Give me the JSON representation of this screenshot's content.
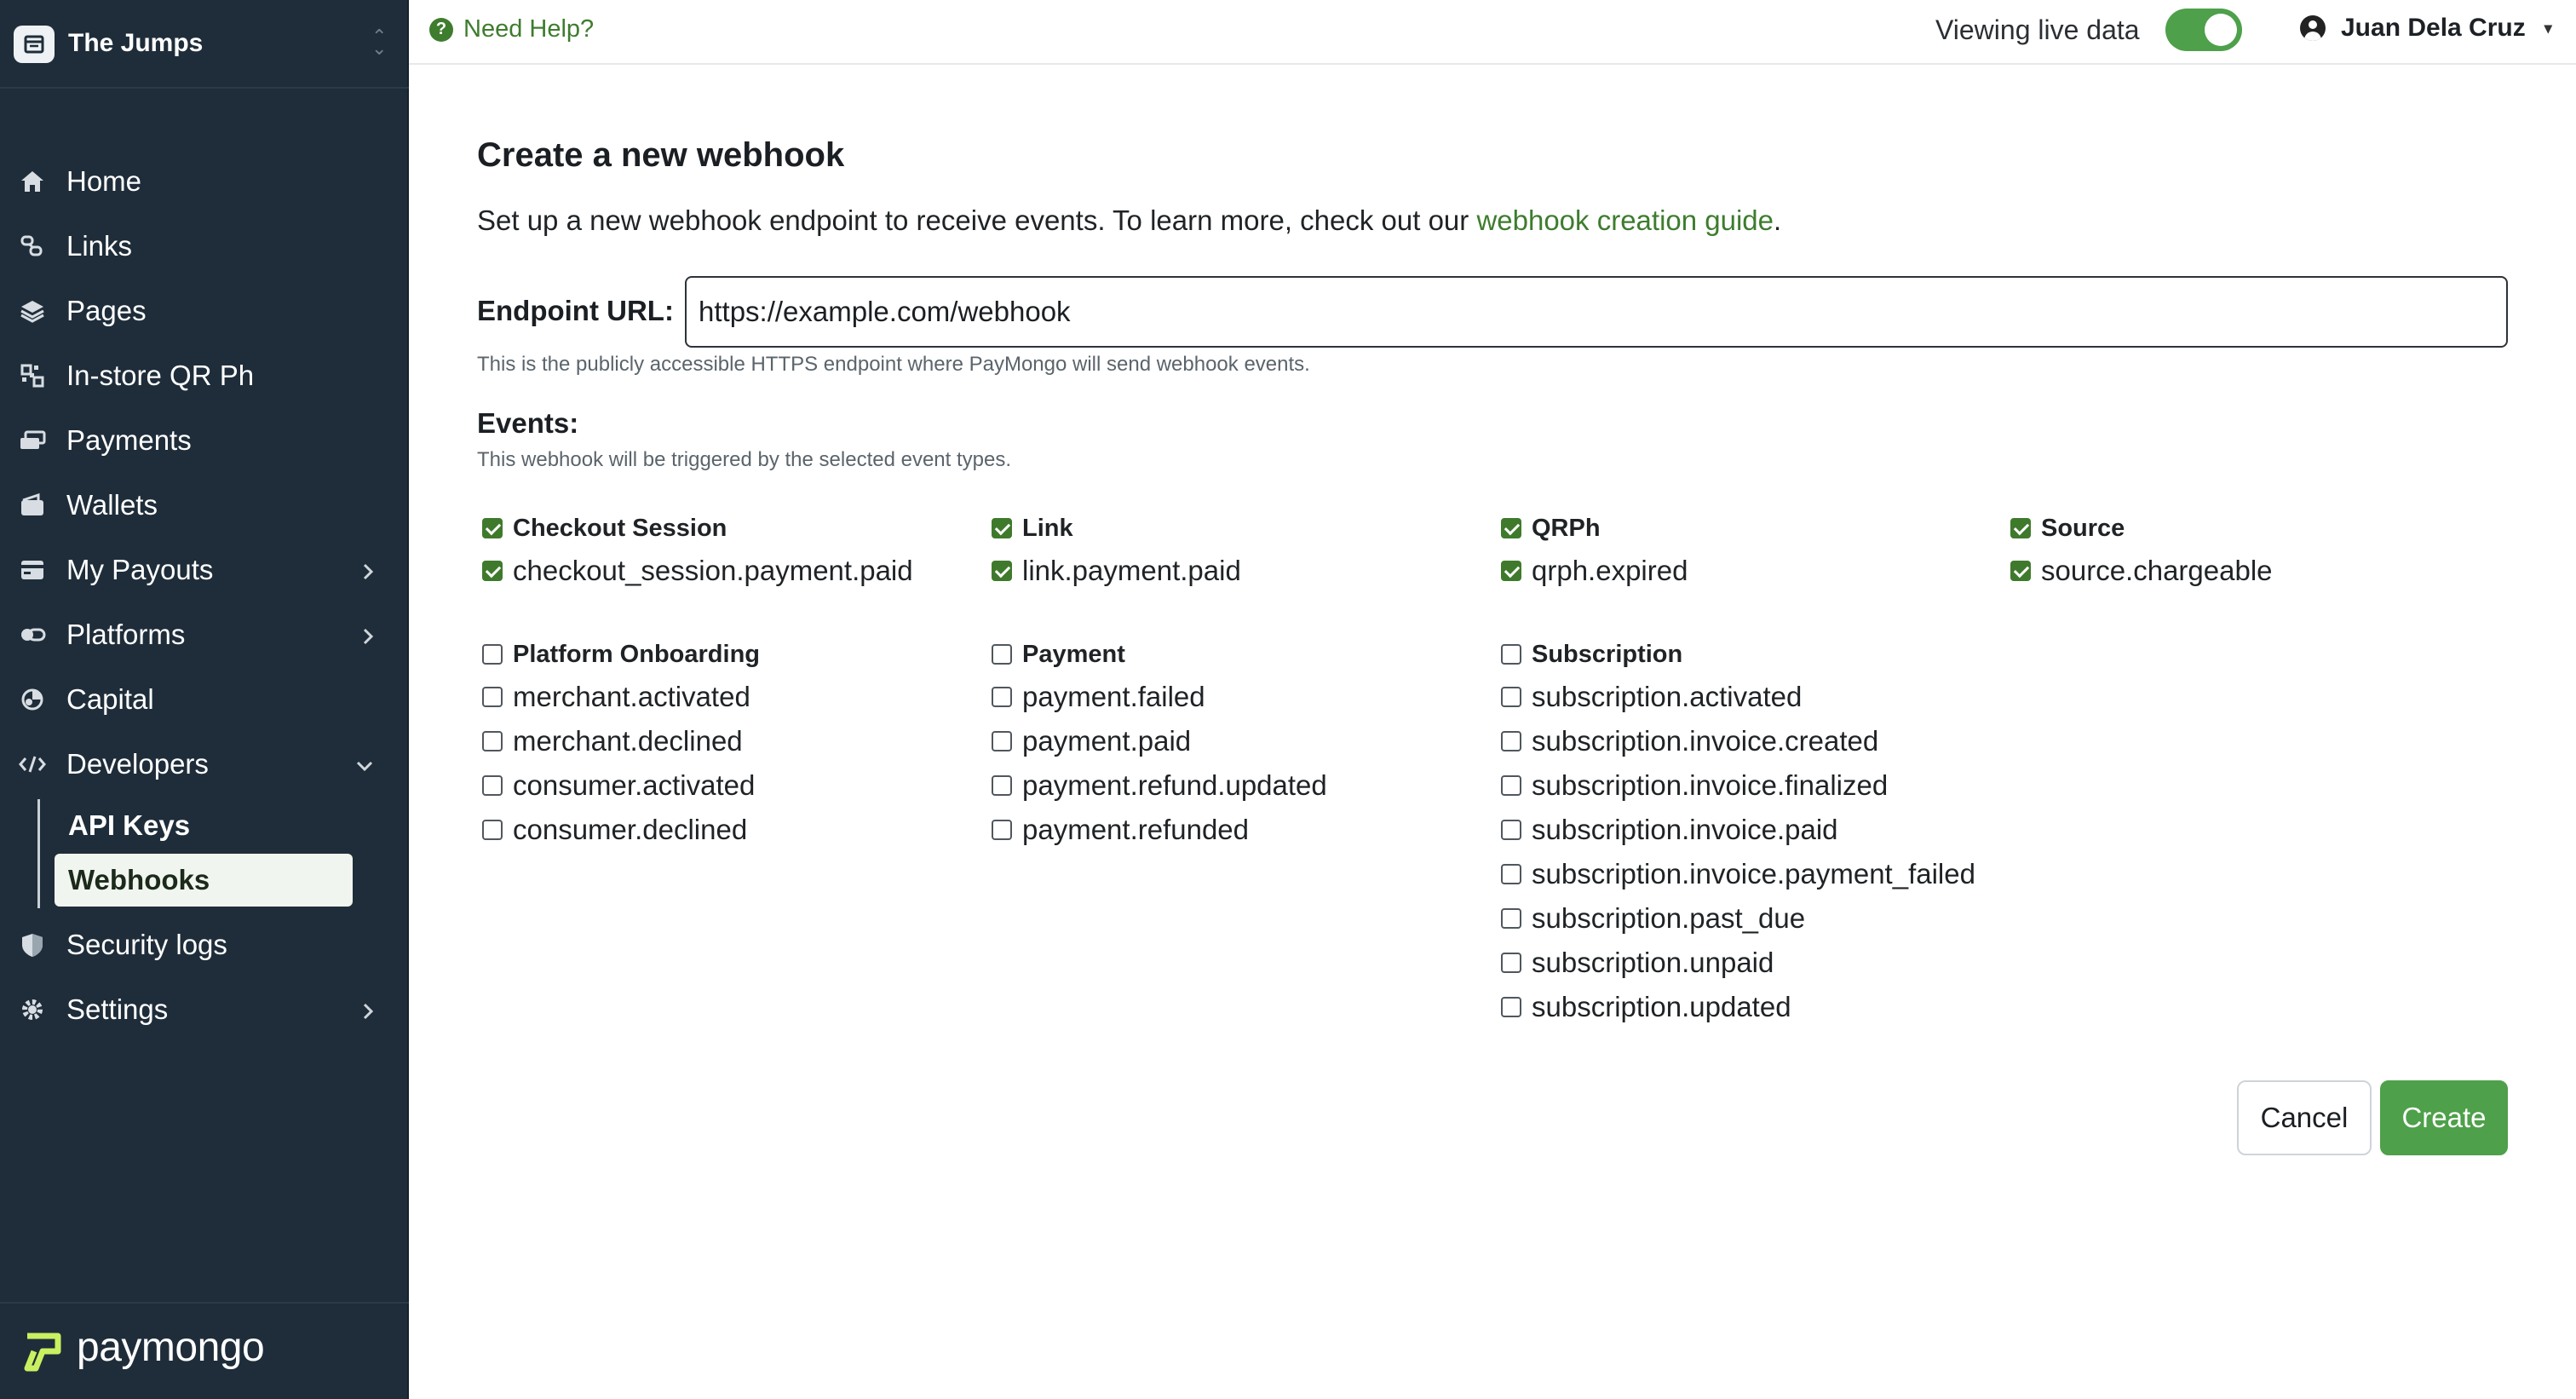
{
  "org": {
    "name": "The Jumps",
    "logo_icon": "storefront-icon",
    "switch_icon": "chevron-updown-icon"
  },
  "sidebar": {
    "items": [
      {
        "label": "Home",
        "icon": "home-icon"
      },
      {
        "label": "Links",
        "icon": "link-icon"
      },
      {
        "label": "Pages",
        "icon": "layers-icon"
      },
      {
        "label": "In-store QR Ph",
        "icon": "qr-code-icon"
      },
      {
        "label": "Payments",
        "icon": "money-icon"
      },
      {
        "label": "Wallets",
        "icon": "wallet-icon"
      },
      {
        "label": "My Payouts",
        "icon": "bank-icon",
        "expandable": true
      },
      {
        "label": "Platforms",
        "icon": "platforms-icon",
        "expandable": true
      },
      {
        "label": "Capital",
        "icon": "capital-icon"
      },
      {
        "label": "Developers",
        "icon": "code-icon",
        "expanded": true
      },
      {
        "label": "Security logs",
        "icon": "shield-icon"
      },
      {
        "label": "Settings",
        "icon": "gear-icon",
        "expandable": true
      }
    ],
    "developers_sub": [
      {
        "label": "API Keys",
        "active": false
      },
      {
        "label": "Webhooks",
        "active": true
      }
    ]
  },
  "brand": {
    "name": "paymongo"
  },
  "topbar": {
    "help": "Need Help?",
    "live_label": "Viewing live data",
    "live_on": true,
    "user": "Juan Dela Cruz"
  },
  "main": {
    "title": "Create a new webhook",
    "intro_prefix": "Set up a new webhook endpoint to receive events. To learn more, check out our ",
    "intro_link": "webhook creation guide",
    "intro_suffix": ".",
    "endpoint_label": "Endpoint URL:",
    "endpoint_value": "https://example.com/webhook",
    "endpoint_help": "This is the publicly accessible HTTPS endpoint where PayMongo will send webhook events.",
    "events_label": "Events:",
    "events_help": "This webhook will be triggered by the selected event types.",
    "groups": [
      {
        "name": "Checkout Session",
        "checked": true,
        "events": [
          {
            "name": "checkout_session.payment.paid",
            "checked": true
          }
        ]
      },
      {
        "name": "Link",
        "checked": true,
        "events": [
          {
            "name": "link.payment.paid",
            "checked": true
          }
        ]
      },
      {
        "name": "QRPh",
        "checked": true,
        "events": [
          {
            "name": "qrph.expired",
            "checked": true
          }
        ]
      },
      {
        "name": "Source",
        "checked": true,
        "events": [
          {
            "name": "source.chargeable",
            "checked": true
          }
        ]
      },
      {
        "name": "Platform Onboarding",
        "checked": false,
        "events": [
          {
            "name": "merchant.activated",
            "checked": false
          },
          {
            "name": "merchant.declined",
            "checked": false
          },
          {
            "name": "consumer.activated",
            "checked": false
          },
          {
            "name": "consumer.declined",
            "checked": false
          }
        ]
      },
      {
        "name": "Payment",
        "checked": false,
        "events": [
          {
            "name": "payment.failed",
            "checked": false
          },
          {
            "name": "payment.paid",
            "checked": false
          },
          {
            "name": "payment.refund.updated",
            "checked": false
          },
          {
            "name": "payment.refunded",
            "checked": false
          }
        ]
      },
      {
        "name": "Subscription",
        "checked": false,
        "events": [
          {
            "name": "subscription.activated",
            "checked": false
          },
          {
            "name": "subscription.invoice.created",
            "checked": false
          },
          {
            "name": "subscription.invoice.finalized",
            "checked": false
          },
          {
            "name": "subscription.invoice.paid",
            "checked": false
          },
          {
            "name": "subscription.invoice.payment_failed",
            "checked": false
          },
          {
            "name": "subscription.past_due",
            "checked": false
          },
          {
            "name": "subscription.unpaid",
            "checked": false
          },
          {
            "name": "subscription.updated",
            "checked": false
          }
        ]
      }
    ],
    "cancel_label": "Cancel",
    "create_label": "Create"
  },
  "colors": {
    "sidebar_bg": "#1f2d3a",
    "accent_green": "#4ea04a",
    "link_green": "#3e7c2e",
    "checkbox_green": "#3f7a2c"
  }
}
